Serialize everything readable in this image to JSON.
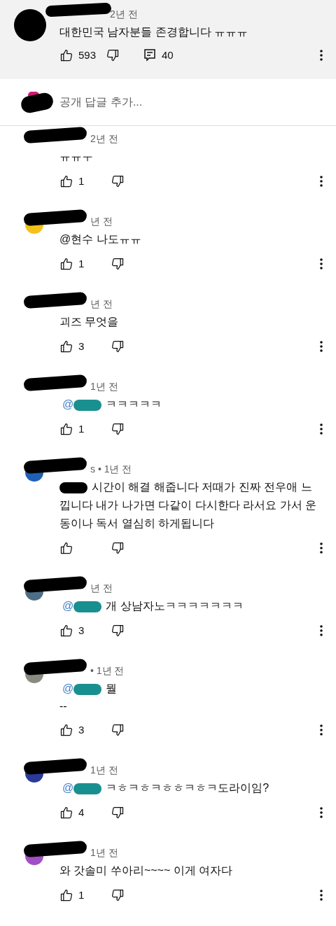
{
  "comment": {
    "time": "2년 전",
    "text": "대한민국 남자분들 존경합니다 ㅠㅠㅠ",
    "likes": "593",
    "replies_count": "40"
  },
  "reply_input": {
    "placeholder": "공개 답글 추가..."
  },
  "replies": [
    {
      "time": "2년 전",
      "text": "ㅠㅠㅜ",
      "likes": "1"
    },
    {
      "time": "년 전",
      "text": "@현수  나도ㅠㅠ",
      "likes": "1",
      "color": "#f2c21b"
    },
    {
      "time": "년 전",
      "text": "괴즈 무엇을",
      "likes": "3"
    },
    {
      "time": "1년 전",
      "mention": {
        "at": "@",
        "color": "#1a8f8f"
      },
      "text": "ㅋㅋㅋㅋㅋ",
      "likes": "1"
    },
    {
      "time": "s • 1년 전",
      "mention": {
        "color": "#000000"
      },
      "text": "시간이 해결 해줍니다 저때가 진짜 전우애 느낍니다 내가 나가면  다같이 다시한다 라서요 가서 운동이나 독서 열심히 하게됩니다",
      "color": "#1f5fb5"
    },
    {
      "time": "년 전",
      "mention": {
        "at": "@",
        "color": "#1a8f8f"
      },
      "text": "개 상남자노ㅋㅋㅋㅋㅋㅋㅋ",
      "likes": "3",
      "color": "#4d6f86"
    },
    {
      "time": "• 1년 전",
      "mention": {
        "at": "@",
        "color": "#1a8f8f"
      },
      "text": "뭘",
      "text_line_2": "--",
      "likes": "3",
      "color": "#8a8a80"
    },
    {
      "time": "1년 전",
      "mention": {
        "at": "@",
        "color": "#1a8f8f"
      },
      "text": "ㅋㅎㅋㅎㅋㅎㅎㅋㅎㅋ도라이임?",
      "likes": "4",
      "color": "#2a3a9a"
    },
    {
      "time": "1년 전",
      "text": "와 갓솔미 쑤아리~~~~ 이게 여자다",
      "likes": "1",
      "color": "#a04fc6"
    }
  ]
}
